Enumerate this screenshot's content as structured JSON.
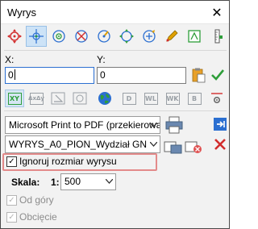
{
  "window": {
    "title": "Wyrys"
  },
  "titlebar": {
    "close_glyph": "✕"
  },
  "toolbar_top": {
    "icons": [
      "move-all-icon",
      "crosshair-icon",
      "target-icon",
      "cross-circle-icon",
      "compass-icon",
      "pan-icon",
      "scale-icon",
      "pen-icon",
      "measure-icon",
      "ruler-icon"
    ]
  },
  "coords": {
    "x_label": "X:",
    "y_label": "Y:",
    "x_value": "0",
    "y_value": "0"
  },
  "toolbar_grid": {
    "buttons": [
      "XY",
      "ΔxΔy",
      "",
      "",
      "D",
      "WL",
      "WK",
      "B"
    ]
  },
  "printer": {
    "selected": "Microsoft Print to PDF (przekierowar",
    "template": "WYRYS_A0_PION_Wydział GN"
  },
  "options": {
    "ignore_size_label": "Ignoruj rozmiar wyrysu",
    "ignore_size_checked": true,
    "from_top_label": "Od góry",
    "from_top_checked": true,
    "crop_label": "Obcięcie",
    "crop_checked": true
  },
  "scale": {
    "label": "Skala:",
    "prefix": "1:",
    "value": "500"
  },
  "colors": {
    "accent_blue": "#2b6fd1",
    "highlight_red": "#e38a8a",
    "check_green": "#2e9e3a",
    "delete_red": "#d22c2c"
  }
}
